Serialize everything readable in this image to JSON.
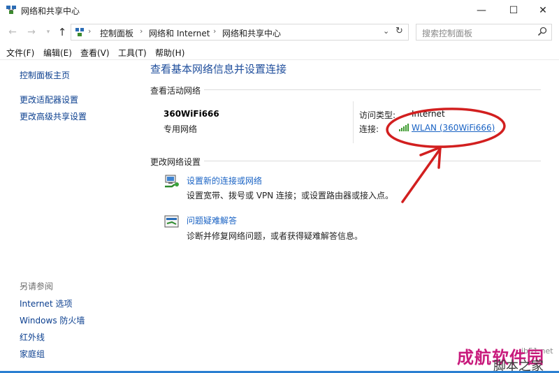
{
  "window": {
    "title": "网络和共享中心",
    "controls": {
      "minimize": "—",
      "maximize": "☐",
      "close": "✕"
    }
  },
  "address_bar": {
    "crumbs": [
      "控制面板",
      "网络和 Internet",
      "网络和共享中心"
    ],
    "separator": "›",
    "search_placeholder": "搜索控制面板"
  },
  "menu": [
    "文件(F)",
    "编辑(E)",
    "查看(V)",
    "工具(T)",
    "帮助(H)"
  ],
  "sidebar": {
    "links": [
      "控制面板主页",
      "更改适配器设置",
      "更改高级共享设置"
    ],
    "see_also_heading": "另请参阅",
    "see_also": [
      "Internet 选项",
      "Windows 防火墙",
      "红外线",
      "家庭组"
    ]
  },
  "main": {
    "title": "查看基本网络信息并设置连接",
    "active_networks_heading": "查看活动网络",
    "network": {
      "name": "360WiFi666",
      "category": "专用网络",
      "access_type_label": "访问类型:",
      "access_type_value": "Internet",
      "connection_label": "连接:",
      "connection_value": "WLAN (360WiFi666)"
    },
    "change_settings_heading": "更改网络设置",
    "tasks": [
      {
        "title": "设置新的连接或网络",
        "desc": "设置宽带、拨号或 VPN 连接；或设置路由器或接入点。",
        "icon": "network-setup-icon"
      },
      {
        "title": "问题疑难解答",
        "desc": "诊断并修复网络问题，或者获得疑难解答信息。",
        "icon": "troubleshoot-icon"
      }
    ]
  },
  "watermark": {
    "main": "成航软件园",
    "url": "jb51.net",
    "sub": "脚本之家"
  },
  "colors": {
    "link": "#1a63c4",
    "title": "#1f4e9c",
    "annotation_red": "#d21f1f",
    "watermark": "#c81a7c"
  }
}
